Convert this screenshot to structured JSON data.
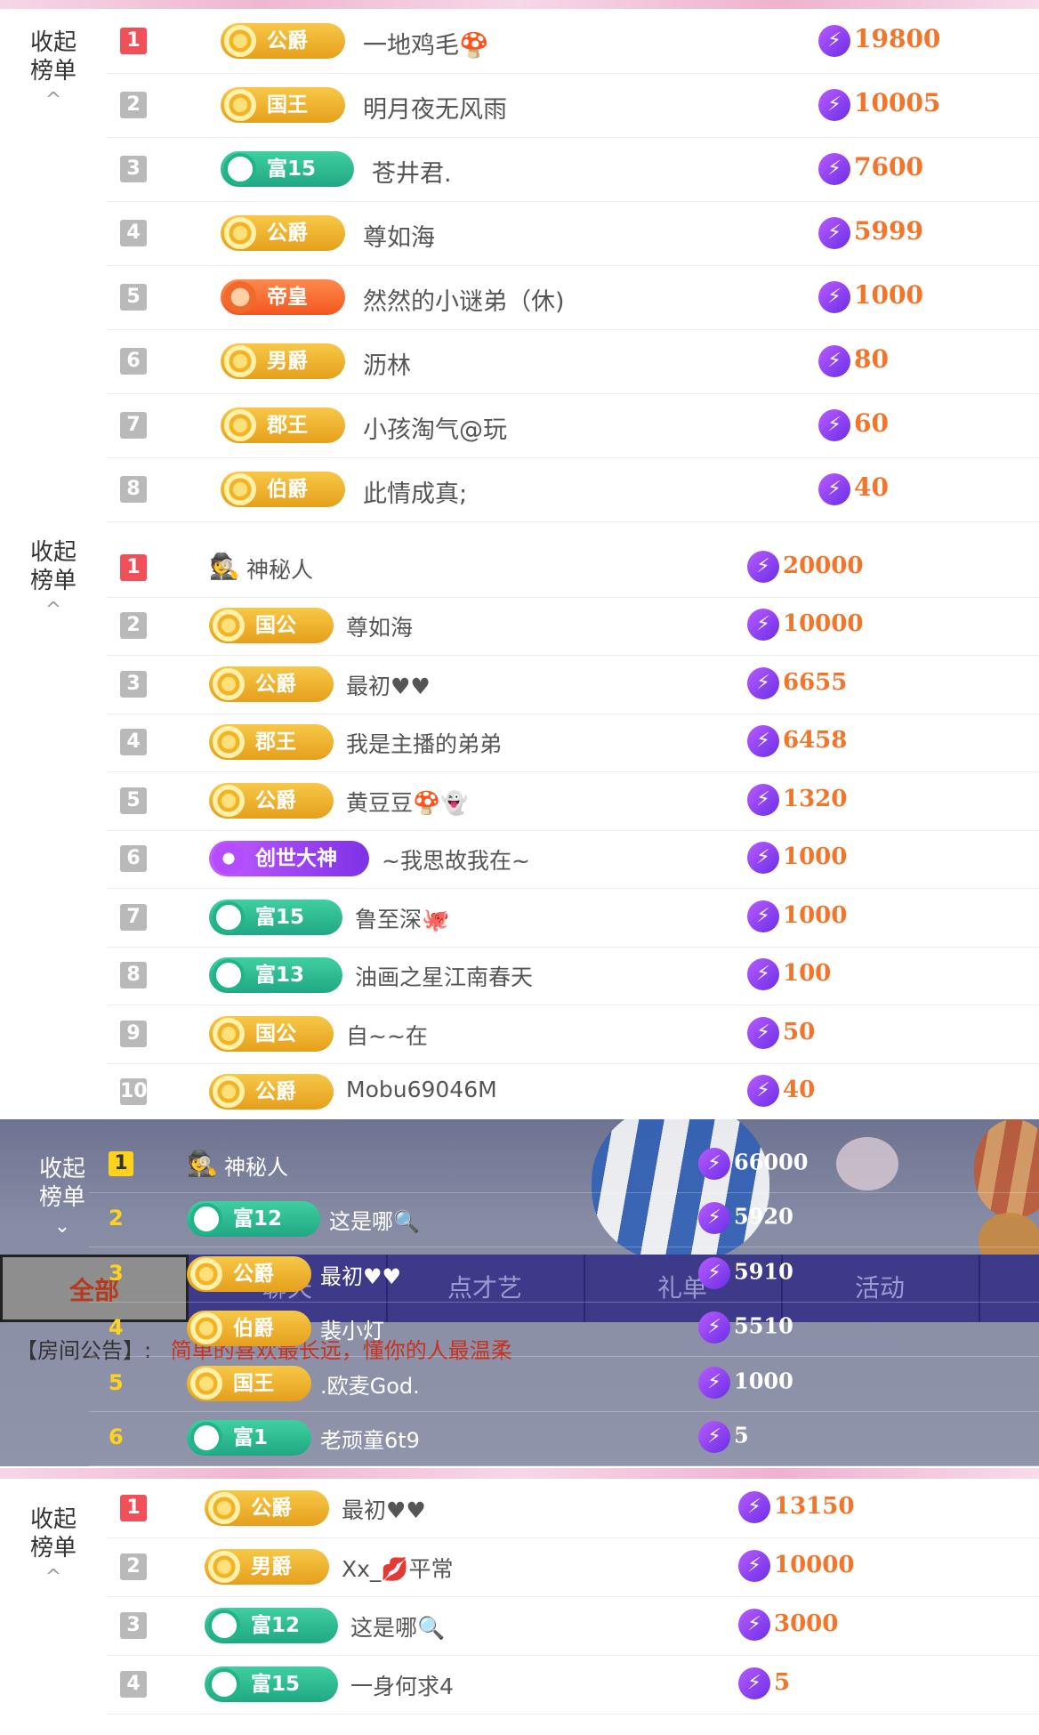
{
  "colors": {
    "rank_top": "#f0505a",
    "rank_other": "#b9b9b9",
    "value": "#f1762c",
    "gold_badge": "#e5a01c",
    "green_badge": "#20a884",
    "tab_bar": "#3d3a8a",
    "notice_red": "#c8311a"
  },
  "section1": {
    "collapse": {
      "line1": "收起",
      "line2": "榜单",
      "chevron": "^"
    },
    "rows": [
      {
        "rank": "1",
        "badge": "公爵",
        "badge_type": "gold",
        "name": "一地鸡毛🍄",
        "value": "19800"
      },
      {
        "rank": "2",
        "badge": "国王",
        "badge_type": "gold",
        "name": "明月夜无风雨",
        "value": "10005"
      },
      {
        "rank": "3",
        "badge": "富15",
        "badge_type": "green",
        "name": "苍井君.",
        "value": "7600"
      },
      {
        "rank": "4",
        "badge": "公爵",
        "badge_type": "gold",
        "name": "尊如海",
        "value": "5999"
      },
      {
        "rank": "5",
        "badge": "帝皇",
        "badge_type": "orange",
        "name": "然然的小谜弟（休)",
        "value": "1000"
      },
      {
        "rank": "6",
        "badge": "男爵",
        "badge_type": "gold",
        "name": "沥林",
        "value": "80"
      },
      {
        "rank": "7",
        "badge": "郡王",
        "badge_type": "gold",
        "name": "小孩淘气@玩",
        "value": "60"
      },
      {
        "rank": "8",
        "badge": "伯爵",
        "badge_type": "gold",
        "name": "此情成真;",
        "value": "40"
      }
    ]
  },
  "section2": {
    "collapse": {
      "line1": "收起",
      "line2": "榜单",
      "chevron": "^"
    },
    "rows": [
      {
        "rank": "1",
        "badge": "",
        "badge_type": "mystery",
        "name": "神秘人",
        "value": "20000"
      },
      {
        "rank": "2",
        "badge": "国公",
        "badge_type": "gold",
        "name": "尊如海",
        "value": "10000"
      },
      {
        "rank": "3",
        "badge": "公爵",
        "badge_type": "gold",
        "name": "最初♥♥",
        "value": "6655"
      },
      {
        "rank": "4",
        "badge": "郡王",
        "badge_type": "gold",
        "name": "我是主播的弟弟",
        "value": "6458"
      },
      {
        "rank": "5",
        "badge": "公爵",
        "badge_type": "gold",
        "name": "黄豆豆🍄👻",
        "value": "1320"
      },
      {
        "rank": "6",
        "badge": "创世大神",
        "badge_type": "purple",
        "name": "~我思故我在~",
        "value": "1000"
      },
      {
        "rank": "7",
        "badge": "富15",
        "badge_type": "green",
        "name": "鲁至深🐙",
        "value": "1000"
      },
      {
        "rank": "8",
        "badge": "富13",
        "badge_type": "green",
        "name": "油画之星江南春天",
        "value": "100"
      },
      {
        "rank": "9",
        "badge": "国公",
        "badge_type": "gold",
        "name": "自~~在",
        "value": "50"
      },
      {
        "rank": "10",
        "badge": "公爵",
        "badge_type": "gold",
        "name": "Mobu69046M",
        "value": "40"
      }
    ]
  },
  "section3": {
    "collapse": {
      "line1": "收起",
      "line2": "榜单",
      "chevron": "⌄"
    },
    "rows": [
      {
        "rank": "1",
        "badge": "",
        "badge_type": "mystery",
        "name": "神秘人",
        "value": "66000"
      },
      {
        "rank": "2",
        "badge": "富12",
        "badge_type": "green",
        "name": "这是哪🔍",
        "value": "5920"
      },
      {
        "rank": "3",
        "badge": "公爵",
        "badge_type": "gold",
        "name": "最初♥♥",
        "value": "5910"
      },
      {
        "rank": "4",
        "badge": "伯爵",
        "badge_type": "gold",
        "name": "裴小灯",
        "value": "5510"
      },
      {
        "rank": "5",
        "badge": "国王",
        "badge_type": "gold",
        "name": ".欧麦God.",
        "value": "1000"
      },
      {
        "rank": "6",
        "badge": "富1",
        "badge_type": "green",
        "name": "老顽童6t9",
        "value": "5"
      }
    ],
    "tabs": [
      "全部",
      "聊天",
      "点才艺",
      "礼单",
      "活动"
    ],
    "notice": {
      "prefix": "【房间公告】:",
      "text": "简单的喜欢最长远，懂你的人最温柔"
    }
  },
  "section4": {
    "collapse": {
      "line1": "收起",
      "line2": "榜单",
      "chevron": "^"
    },
    "rows": [
      {
        "rank": "1",
        "badge": "公爵",
        "badge_type": "gold",
        "name": "最初♥♥",
        "value": "13150"
      },
      {
        "rank": "2",
        "badge": "男爵",
        "badge_type": "gold",
        "name": "Xx_💋平常",
        "value": "10000"
      },
      {
        "rank": "3",
        "badge": "富12",
        "badge_type": "green",
        "name": "这是哪🔍",
        "value": "3000"
      },
      {
        "rank": "4",
        "badge": "富15",
        "badge_type": "green",
        "name": "一身何求4",
        "value": "5"
      }
    ]
  }
}
